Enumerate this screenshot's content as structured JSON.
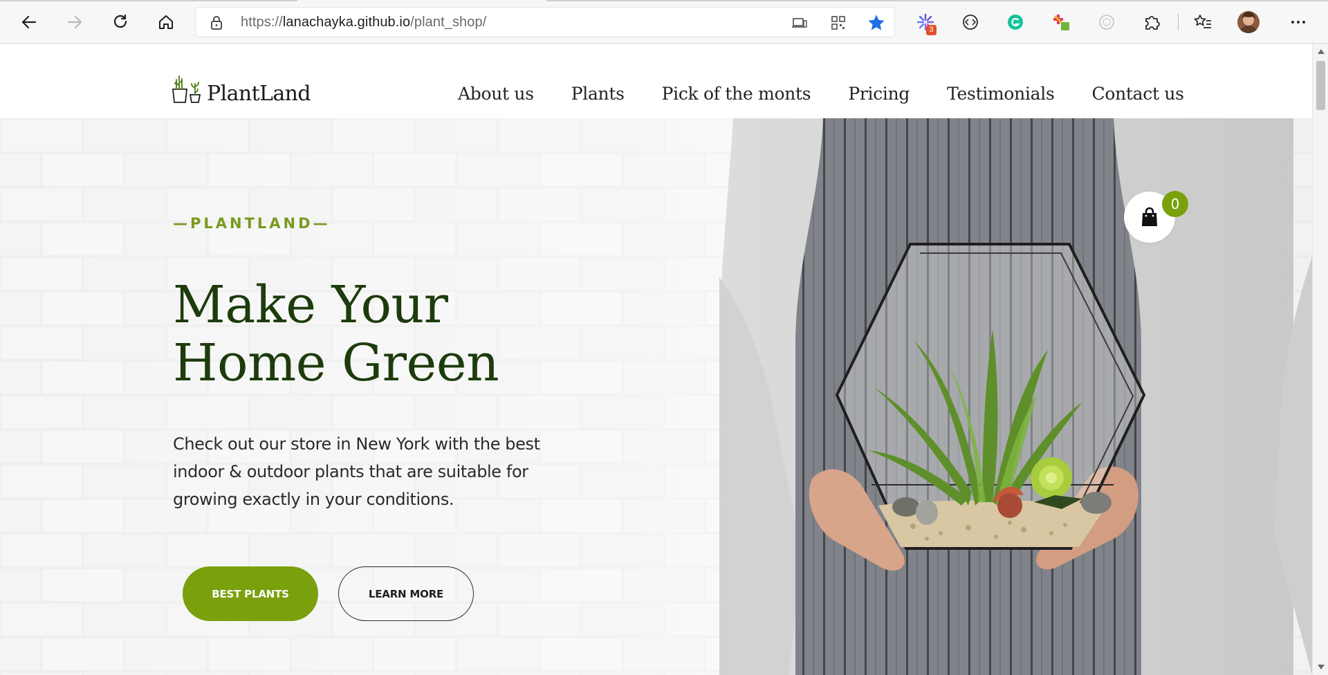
{
  "browser": {
    "url_prefix": "https://",
    "url_host": "lanachayka.github.io",
    "url_path": "/plant_shop/",
    "extension_badge": "3",
    "colors": {
      "favorite_star": "#1f6fe5",
      "grammarly": "#15c39a",
      "badge": "#e0522a"
    }
  },
  "site": {
    "logo_text": "PlantLand",
    "nav": [
      "About us",
      "Plants",
      "Pick of the monts",
      "Pricing",
      "Testimonials",
      "Contact us"
    ],
    "cart_count": "0"
  },
  "hero": {
    "eyebrow": "—PLANTLAND—",
    "title_line1": "Make Your",
    "title_line2": "Home Green",
    "description": "Check out our store in New York with the best indoor & outdoor plants that are suitable for growing exactly in your conditions.",
    "primary_button": "BEST PLANTS",
    "secondary_button": "LEARN MORE"
  },
  "colors": {
    "brand_green": "#7aa00c",
    "title_green": "#1d3b0c",
    "eyebrow_green": "#7a9a1e"
  }
}
